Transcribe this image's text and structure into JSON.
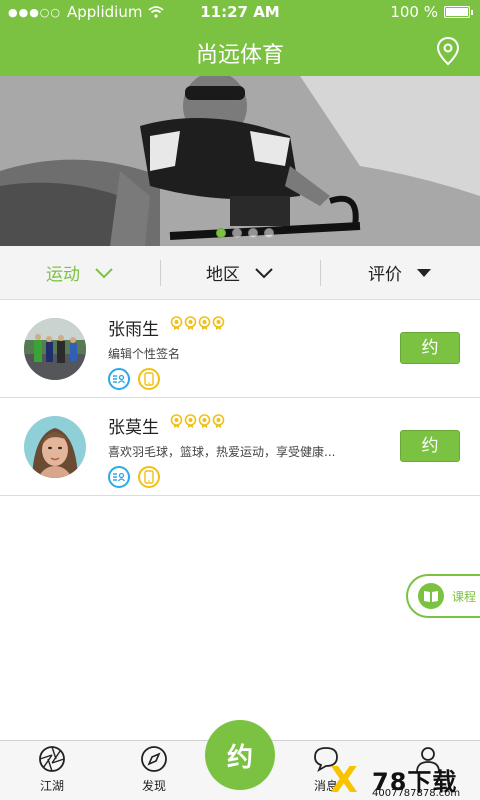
{
  "status_bar": {
    "carrier": "Applidium",
    "time": "11:27 AM",
    "battery": "100 %"
  },
  "header": {
    "title": "尚远体育",
    "location_icon": "location-pin-icon"
  },
  "banner": {
    "dot_count": 4,
    "active_dot": 0
  },
  "filters": [
    {
      "label": "运动",
      "indicator": "chevron-down",
      "active": true
    },
    {
      "label": "地区",
      "indicator": "chevron-down",
      "active": false
    },
    {
      "label": "评价",
      "indicator": "triangle-down",
      "active": false
    }
  ],
  "coaches": [
    {
      "name": "张雨生",
      "rating": 4,
      "desc": "编辑个性签名",
      "button": "约"
    },
    {
      "name": "张莫生",
      "rating": 4,
      "desc": "喜欢羽毛球，篮球，热爱运动，享受健康...",
      "button": "约"
    }
  ],
  "course_button": {
    "label": "课程"
  },
  "tabs": [
    {
      "label": "江湖",
      "icon": "aperture-icon"
    },
    {
      "label": "发现",
      "icon": "compass-icon"
    },
    {
      "label": "消息",
      "icon": "chat-icon"
    },
    {
      "label": "",
      "icon": "person-icon"
    }
  ],
  "center_button": {
    "label": "约"
  },
  "watermark": {
    "mark": "X",
    "big": "78下载",
    "small": "4007787878.com"
  },
  "colors": {
    "brand_green": "#7cc242",
    "tag_blue": "#2ea9e8",
    "tag_yellow": "#f2c012"
  }
}
